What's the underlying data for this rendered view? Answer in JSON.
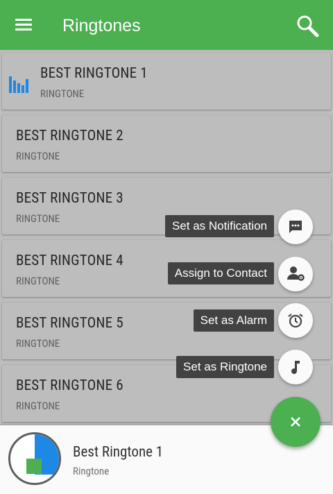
{
  "app_bar": {
    "title": "Ringtones",
    "color": "#4caf50",
    "menu_icon": "menu-icon",
    "search_icon": "search-icon"
  },
  "list": {
    "items": [
      {
        "title": "BEST RINGTONE 1",
        "subtitle": "RINGTONE",
        "playing": true
      },
      {
        "title": "BEST RINGTONE 2",
        "subtitle": "RINGTONE",
        "playing": false
      },
      {
        "title": "BEST RINGTONE 3",
        "subtitle": "RINGTONE",
        "playing": false
      },
      {
        "title": "BEST RINGTONE 4",
        "subtitle": "RINGTONE",
        "playing": false
      },
      {
        "title": "BEST RINGTONE 5",
        "subtitle": "RINGTONE",
        "playing": false
      },
      {
        "title": "BEST RINGTONE 6",
        "subtitle": "RINGTONE",
        "playing": false
      }
    ]
  },
  "speed_dial": {
    "actions": [
      {
        "label": "Set as Notification",
        "icon": "message-icon"
      },
      {
        "label": "Assign to Contact",
        "icon": "contact-settings-icon"
      },
      {
        "label": "Set as Alarm",
        "icon": "alarm-icon"
      },
      {
        "label": "Set as Ringtone",
        "icon": "music-note-icon"
      }
    ],
    "close_icon": "close-icon",
    "fab_color": "#4caf50"
  },
  "player": {
    "title": "Best Ringtone 1",
    "subtitle": "Ringtone",
    "accent": "#1e88e5"
  }
}
